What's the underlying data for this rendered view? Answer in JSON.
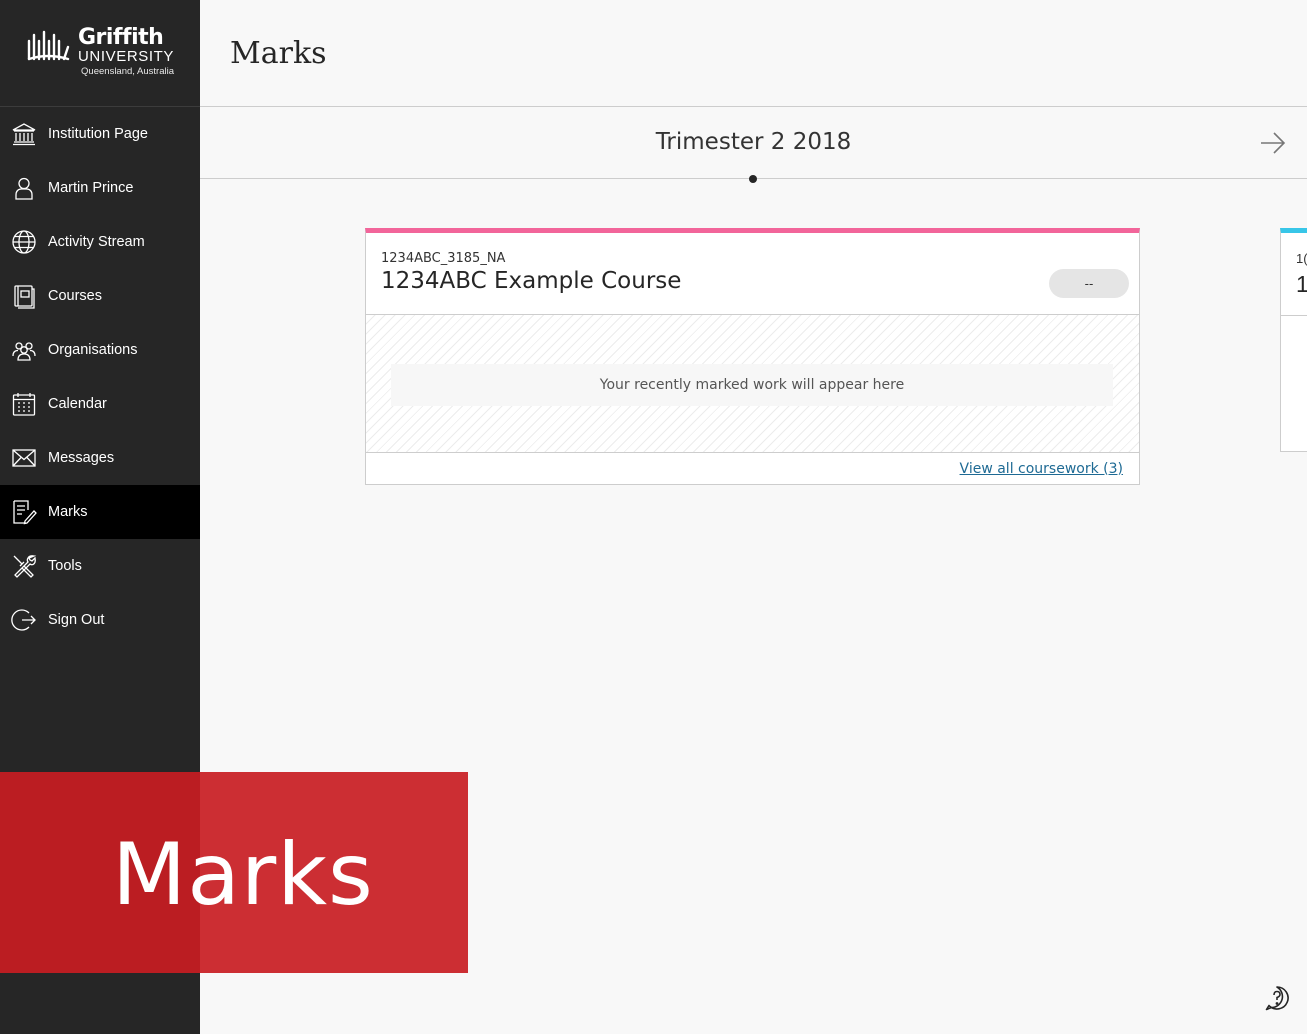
{
  "logo": {
    "line1": "Griffith",
    "line2": "UNIVERSITY",
    "line3": "Queensland, Australia"
  },
  "nav": [
    {
      "label": "Institution Page",
      "icon": "institution-icon"
    },
    {
      "label": "Martin Prince",
      "icon": "user-icon"
    },
    {
      "label": "Activity Stream",
      "icon": "globe-icon"
    },
    {
      "label": "Courses",
      "icon": "courses-icon"
    },
    {
      "label": "Organisations",
      "icon": "organisations-icon"
    },
    {
      "label": "Calendar",
      "icon": "calendar-icon"
    },
    {
      "label": "Messages",
      "icon": "envelope-icon"
    },
    {
      "label": "Marks",
      "icon": "marks-icon",
      "active": true
    },
    {
      "label": "Tools",
      "icon": "tools-icon"
    },
    {
      "label": "Sign Out",
      "icon": "sign-out-icon"
    }
  ],
  "header": {
    "title": "Marks"
  },
  "term": {
    "title": "Trimester 2 2018"
  },
  "course_card": {
    "id": "1234ABC_3185_NA",
    "name": "1234ABC Example Course",
    "grade": "--",
    "empty_message": "Your recently marked work will appear here",
    "link": "View all coursework (3)",
    "accent": "#f2659a"
  },
  "peek_card": {
    "id_fragment": "1(",
    "name_fragment": "1",
    "accent": "#38c6e8"
  },
  "banner": {
    "text": "Marks",
    "color": "#c81c22"
  },
  "colors": {
    "sidebar": "#262626",
    "active": "#000000",
    "link": "#1e6a94"
  }
}
